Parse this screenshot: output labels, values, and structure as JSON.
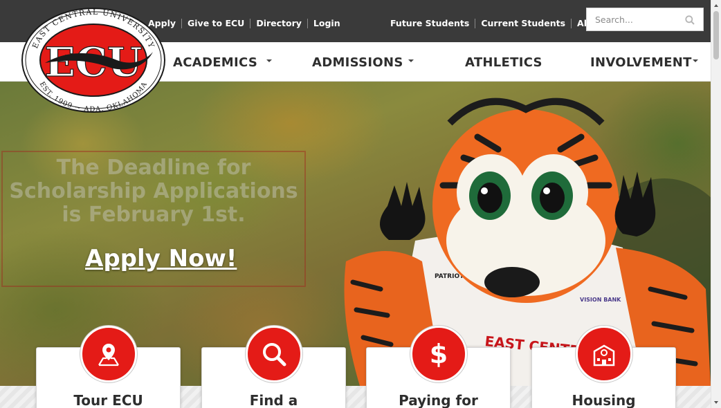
{
  "utility_nav": {
    "left": [
      "Apply",
      "Give to ECU",
      "Directory",
      "Login"
    ],
    "right": [
      "Future Students",
      "Current Students",
      "Alumni"
    ]
  },
  "search": {
    "placeholder": "Search..."
  },
  "logo": {
    "arc_top": "EAST CENTRAL UNIVERSITY",
    "arc_bottom": "EST. 1909 ~ ADA, OKLAHOMA",
    "initials": "ECU"
  },
  "main_nav": [
    {
      "label": "ACADEMICS",
      "has_dropdown": true
    },
    {
      "label": "ADMISSIONS",
      "has_dropdown": true
    },
    {
      "label": "ATHLETICS",
      "has_dropdown": false
    },
    {
      "label": "INVOLVEMENT",
      "has_dropdown": true
    }
  ],
  "hero": {
    "banner_lines": [
      "The Deadline for",
      "Scholarship Applications",
      "is February 1st."
    ],
    "cta": "Apply Now!",
    "mascot_patch": "PATRIOT",
    "sponsor": "VISION BANK",
    "jersey": "EAST CENTRAL"
  },
  "cards": [
    {
      "label": "Tour ECU",
      "icon": "map-pin-icon"
    },
    {
      "label": "Find a",
      "icon": "search-icon"
    },
    {
      "label": "Paying for",
      "icon": "dollar-icon"
    },
    {
      "label": "Housing",
      "icon": "building-icon"
    }
  ],
  "colors": {
    "brand_red": "#e41b17",
    "topbar": "#3a3a3a",
    "nav_text": "#2e2e2e"
  }
}
